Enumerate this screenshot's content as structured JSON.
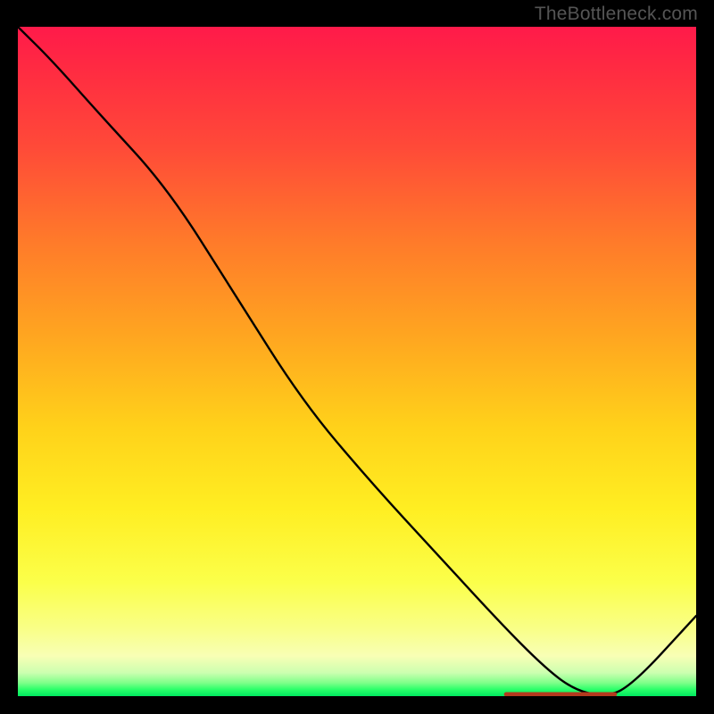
{
  "watermark": "TheBottleneck.com",
  "marker_label": "",
  "colors": {
    "line": "#000000",
    "marker_text": "#b33a1e"
  },
  "chart_data": {
    "type": "line",
    "title": "",
    "xlabel": "",
    "ylabel": "",
    "xlim": [
      0,
      100
    ],
    "ylim": [
      0,
      100
    ],
    "grid": false,
    "series": [
      {
        "name": "curve",
        "x": [
          0,
          5,
          12,
          22,
          32,
          42,
          52,
          62,
          72,
          78,
          82,
          86,
          90,
          100
        ],
        "y": [
          100,
          95,
          87,
          76,
          60,
          44,
          32,
          21,
          10,
          4,
          1,
          0,
          1,
          12
        ]
      }
    ],
    "marker": {
      "x_start": 72,
      "x_end": 88,
      "y": 0
    },
    "background_gradient": {
      "top": "#ff1a4a",
      "mid_high": "#ffa520",
      "mid": "#ffee22",
      "low": "#f8ffb5",
      "bottom": "#00e860"
    }
  }
}
